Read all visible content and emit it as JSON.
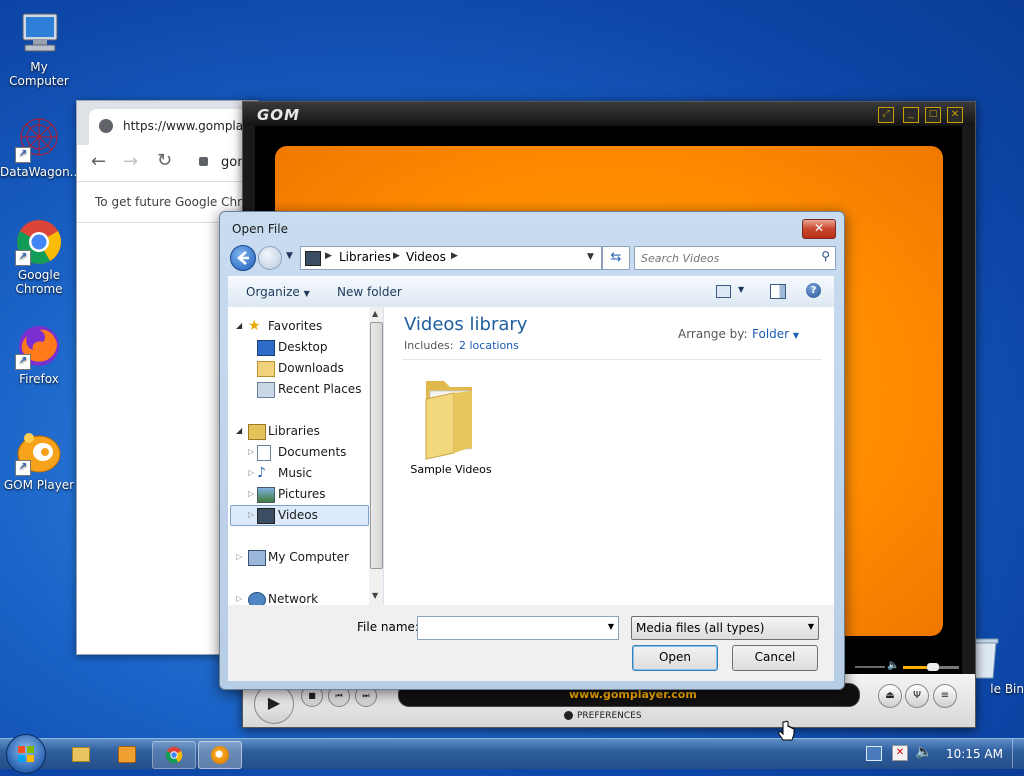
{
  "desktop": {
    "icons": [
      {
        "label": "My Computer"
      },
      {
        "label": "DataWagon..."
      },
      {
        "label": "Google Chrome"
      },
      {
        "label": "Firefox"
      },
      {
        "label": "GOM Player"
      },
      {
        "label": "le Bin"
      }
    ]
  },
  "chrome": {
    "tab_url": "https://www.gomplayer",
    "address_partial": "gom",
    "infobar_text": "To get future Google Chro"
  },
  "gom": {
    "logo": "GOM",
    "footer_url": "www.gomplayer.com",
    "preferences_label": "PREFERENCES",
    "colors": {
      "video": "#ff8c00",
      "accent": "#ffb000"
    }
  },
  "dialog": {
    "title": "Open File",
    "close_label": "✕",
    "breadcrumb": [
      "Libraries",
      "Videos"
    ],
    "search_placeholder": "Search Videos",
    "toolbar": {
      "organize": "Organize",
      "new_folder": "New folder"
    },
    "nav": {
      "favorites": "Favorites",
      "desktop": "Desktop",
      "downloads": "Downloads",
      "recent": "Recent Places",
      "libraries": "Libraries",
      "documents": "Documents",
      "music": "Music",
      "pictures": "Pictures",
      "videos": "Videos",
      "computer": "My Computer",
      "network": "Network"
    },
    "library": {
      "title": "Videos library",
      "includes_label": "Includes:",
      "locations": "2 locations",
      "arrange_label": "Arrange by:",
      "arrange_value": "Folder"
    },
    "items": [
      {
        "name": "Sample Videos"
      }
    ],
    "filename_label": "File name:",
    "filename_value": "",
    "filetype": "Media files (all types)",
    "open_label": "Open",
    "cancel_label": "Cancel"
  },
  "taskbar": {
    "clock": "10:15 AM"
  }
}
